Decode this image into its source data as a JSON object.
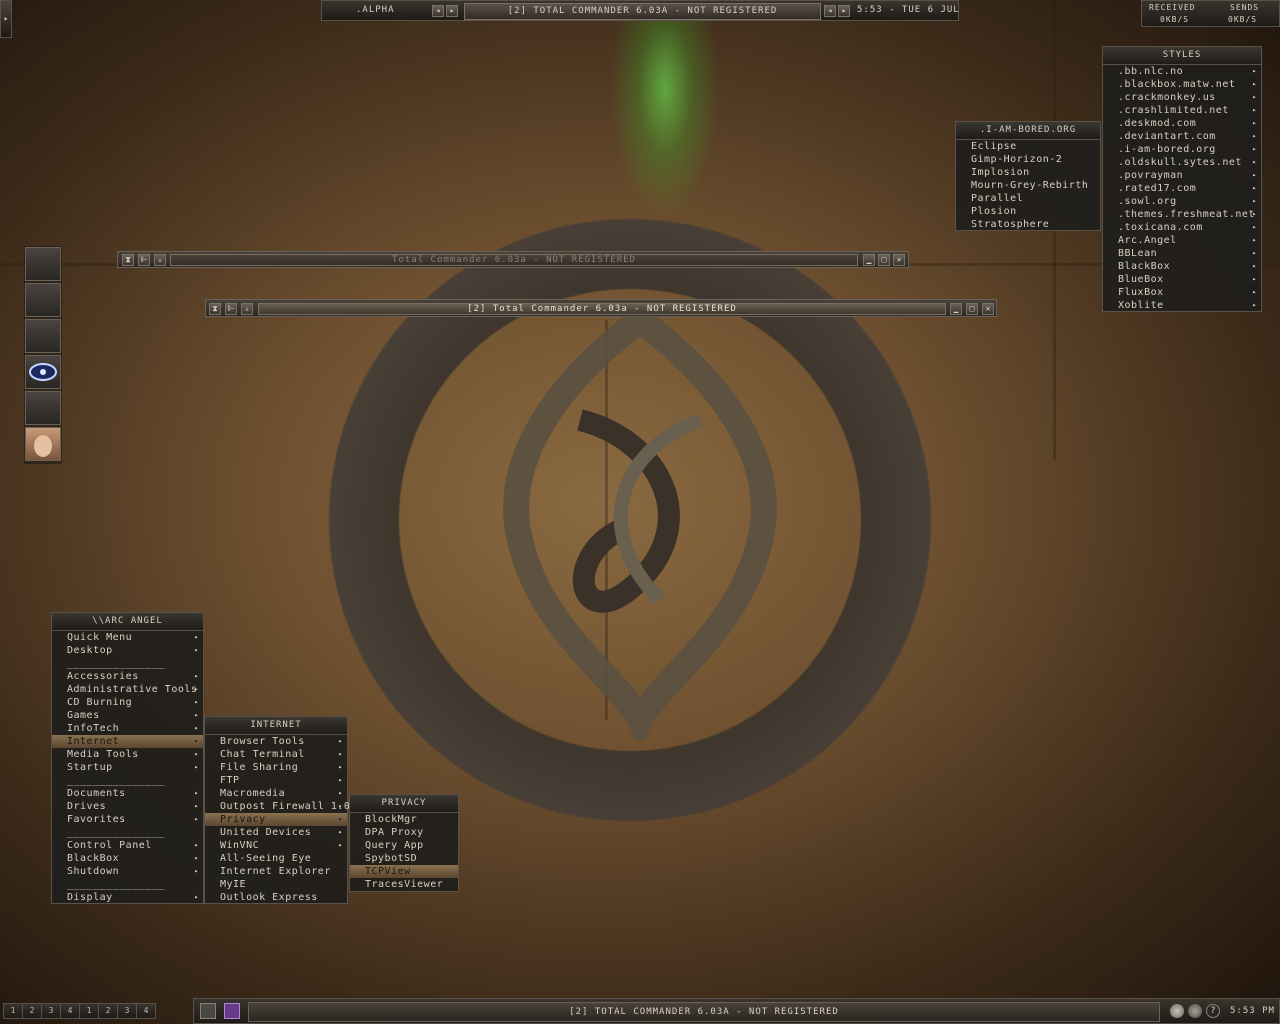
{
  "top_bar": {
    "workspace": ".ALPHA",
    "window_title": "[2] TOTAL COMMANDER 6.03A - NOT REGISTERED",
    "clock": "5:53 - TUE 6 JUL"
  },
  "net_monitor": {
    "received_label": "RECEIVED",
    "received_value": "0KB/S",
    "sends_label": "SENDS",
    "sends_value": "0KB/S"
  },
  "styles_menu": {
    "title": "STYLES",
    "items": [
      ".bb.nlc.no",
      ".blackbox.matw.net",
      ".crackmonkey.us",
      ".crashlimited.net",
      ".deskmod.com",
      ".deviantart.com",
      ".i-am-bored.org",
      ".oldskull.sytes.net",
      ".povrayman",
      ".rated17.com",
      ".sowl.org",
      ".themes.freshmeat.net",
      ".toxicana.com",
      "Arc.Angel",
      "BBLean",
      "BlackBox",
      "BlueBox",
      "FluxBox",
      "Xoblite"
    ]
  },
  "iamb_menu": {
    "title": ".I-AM-BORED.ORG",
    "items": [
      "Eclipse",
      "Gimp-Horizon-2",
      "Implosion",
      "Mourn-Grey-Rebirth",
      "Parallel",
      "Plosion",
      "Stratosphere"
    ]
  },
  "windows": {
    "back_title": "Total Commander 6.03a - NOT REGISTERED",
    "front_title": "[2] Total Commander 6.03a - NOT REGISTERED"
  },
  "main_menu": {
    "title": "\\\\ARC ANGEL",
    "items": [
      {
        "label": "Quick Menu",
        "sub": true
      },
      {
        "label": "Desktop",
        "sub": true
      },
      {
        "label": "_______________",
        "sub": false
      },
      {
        "label": "Accessories",
        "sub": true
      },
      {
        "label": "Administrative Tools",
        "sub": true
      },
      {
        "label": "CD Burning",
        "sub": true
      },
      {
        "label": "Games",
        "sub": true
      },
      {
        "label": "InfoTech",
        "sub": true
      },
      {
        "label": "Internet",
        "sub": true
      },
      {
        "label": "Media Tools",
        "sub": true
      },
      {
        "label": "Startup",
        "sub": true
      },
      {
        "label": "_______________",
        "sub": false
      },
      {
        "label": "Documents",
        "sub": true
      },
      {
        "label": "Drives",
        "sub": true
      },
      {
        "label": "Favorites",
        "sub": true
      },
      {
        "label": "_______________",
        "sub": false
      },
      {
        "label": "Control Panel",
        "sub": true
      },
      {
        "label": "BlackBox",
        "sub": true
      },
      {
        "label": "Shutdown",
        "sub": true
      },
      {
        "label": "_______________",
        "sub": false
      },
      {
        "label": "Display",
        "sub": true
      }
    ]
  },
  "internet_menu": {
    "title": "INTERNET",
    "items": [
      {
        "label": "Browser Tools",
        "sub": true
      },
      {
        "label": "Chat Terminal",
        "sub": true
      },
      {
        "label": "File Sharing",
        "sub": true
      },
      {
        "label": "FTP",
        "sub": true
      },
      {
        "label": "Macromedia",
        "sub": true
      },
      {
        "label": "Outpost Firewall 1.0",
        "sub": true
      },
      {
        "label": "Privacy",
        "sub": true
      },
      {
        "label": "United Devices",
        "sub": true
      },
      {
        "label": "WinVNC",
        "sub": true
      },
      {
        "label": "All-Seeing Eye",
        "sub": false
      },
      {
        "label": "Internet Explorer",
        "sub": false
      },
      {
        "label": "MyIE",
        "sub": false
      },
      {
        "label": "Outlook Express",
        "sub": false
      }
    ]
  },
  "privacy_menu": {
    "title": "PRIVACY",
    "items": [
      "BlockMgr",
      "DPA Proxy",
      "Query App",
      "SpybotSD",
      "TCPView",
      "TracesViewer"
    ]
  },
  "taskbar": {
    "workspaces": [
      "1",
      "2",
      "3",
      "4",
      "1",
      "2",
      "3",
      "4"
    ],
    "task": "[2] TOTAL COMMANDER 6.03A - NOT REGISTERED",
    "help": "?",
    "clock": "5:53 PM"
  }
}
